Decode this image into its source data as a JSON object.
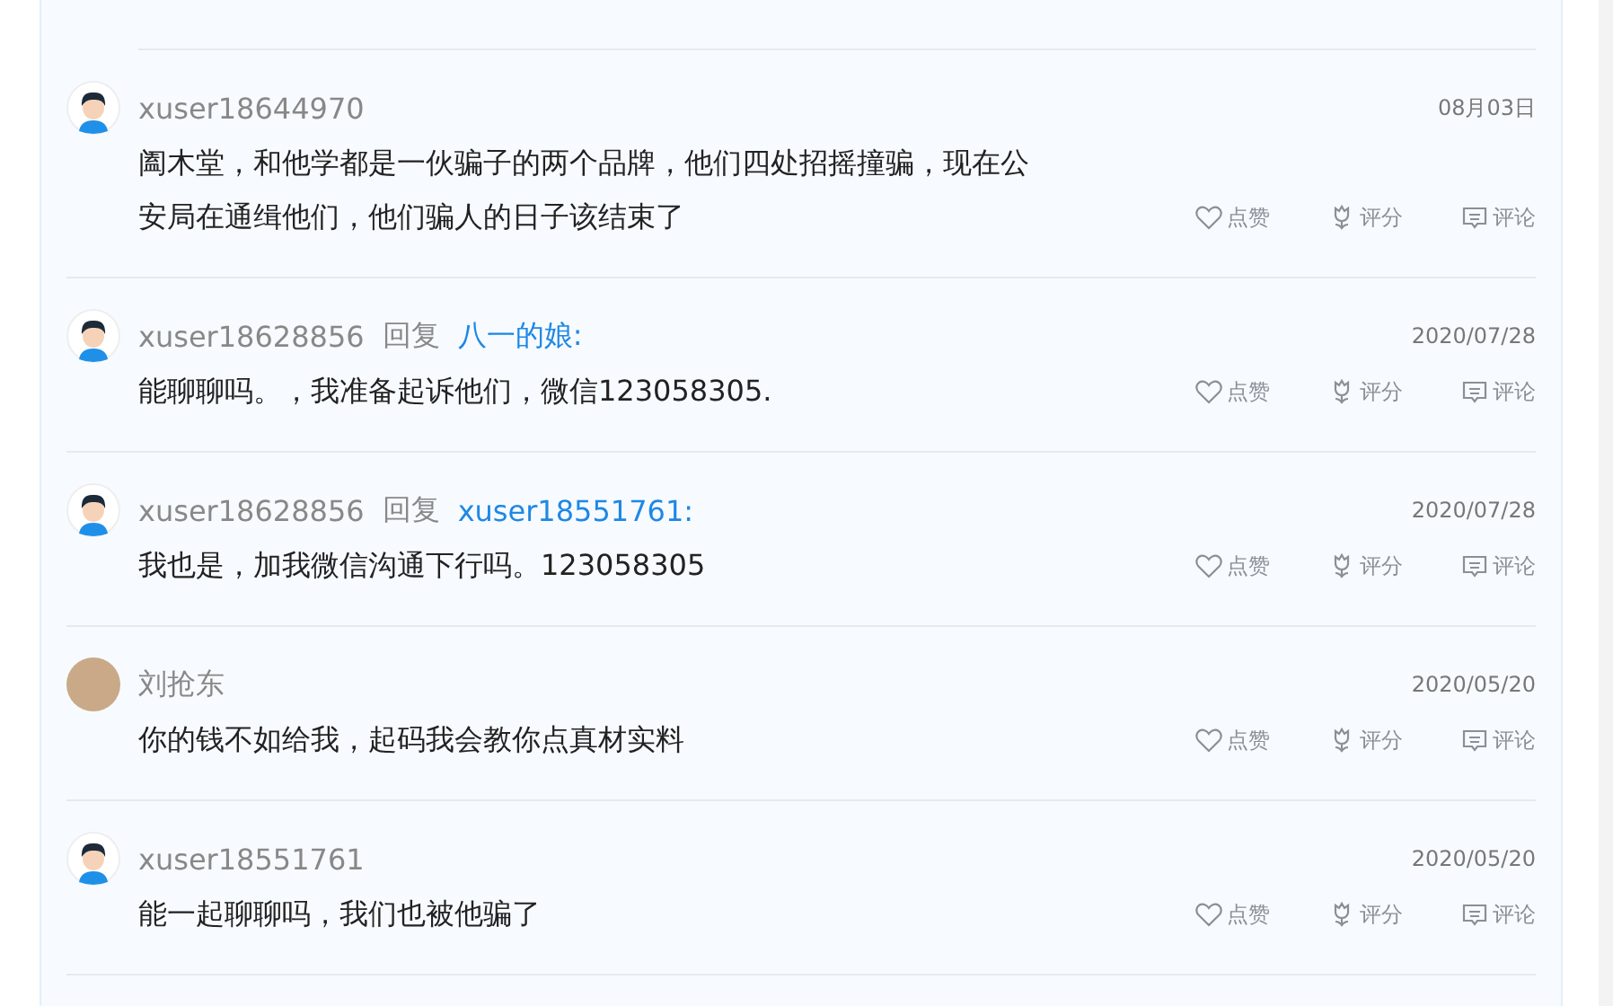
{
  "comments": [
    {
      "user": "xuser18644970",
      "kind": "cartoon",
      "date": "08月03日",
      "text": "阖木堂，和他学都是一伙骗子的两个品牌，他们四处招摇撞骗，现在公安局在通缉他们，他们骗人的日子该结束了",
      "actions": [
        {
          "kind": "like",
          "label": "点赞"
        },
        {
          "kind": "rate",
          "label": "评分"
        },
        {
          "kind": "comment",
          "label": "评论"
        }
      ]
    },
    {
      "user": "xuser18628856",
      "kind": "cartoon",
      "reply_label": "回复",
      "reply_to": "八一的娘:",
      "date": "2020/07/28",
      "text": "能聊聊吗。，我准备起诉他们，微信123058305.",
      "actions": [
        {
          "kind": "like",
          "label": "点赞"
        },
        {
          "kind": "rate",
          "label": "评分"
        },
        {
          "kind": "comment",
          "label": "评论"
        }
      ]
    },
    {
      "user": "xuser18628856",
      "kind": "cartoon",
      "reply_label": "回复",
      "reply_to": "xuser18551761:",
      "date": "2020/07/28",
      "text": "我也是，加我微信沟通下行吗。123058305",
      "actions": [
        {
          "kind": "like",
          "label": "点赞"
        },
        {
          "kind": "rate",
          "label": "评分"
        },
        {
          "kind": "comment",
          "label": "评论"
        }
      ]
    },
    {
      "user": "刘抢东",
      "kind": "photo",
      "date": "2020/05/20",
      "text": "你的钱不如给我，起码我会教你点真材实料",
      "actions": [
        {
          "kind": "like",
          "label": "点赞"
        },
        {
          "kind": "rate",
          "label": "评分"
        },
        {
          "kind": "comment",
          "label": "评论"
        }
      ]
    },
    {
      "user": "xuser18551761",
      "kind": "cartoon",
      "date": "2020/05/20",
      "text": "能一起聊聊吗，我们也被他骗了",
      "actions": [
        {
          "kind": "like",
          "label": "点赞"
        },
        {
          "kind": "rate",
          "label": "评分"
        },
        {
          "kind": "comment",
          "label": "评论"
        }
      ]
    }
  ]
}
